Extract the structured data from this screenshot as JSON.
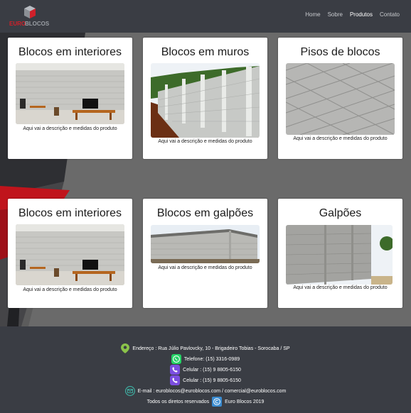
{
  "brand": {
    "logo_text": "EUROBLOCOS",
    "accent": "#d0202a"
  },
  "nav": {
    "items": [
      "Home",
      "Sobre",
      "Produtos",
      "Contato"
    ],
    "active": "Produtos"
  },
  "products": [
    {
      "title": "Blocos em interiores",
      "description": "Aqui vai a descrição e medidas do produto",
      "image": "interior-room"
    },
    {
      "title": "Blocos em muros",
      "description": "Aqui vai a descrição e medidas do produto",
      "image": "block-wall"
    },
    {
      "title": "Pisos de blocos",
      "description": "Aqui vai a descrição e medidas do produto",
      "image": "paving"
    },
    {
      "title": "Blocos em interiores",
      "description": "Aqui vai a descrição e medidas do produto",
      "image": "interior-room"
    },
    {
      "title": "Blocos em galpões",
      "description": "Aqui vai a descrição e medidas do produto",
      "image": "warehouse"
    },
    {
      "title": "Galpões",
      "description": "Aqui vai a descrição e medidas do produto",
      "image": "shed"
    }
  ],
  "footer": {
    "address": "Endereço : Rua Júlio Pavlovcky, 10 - Brigadeiro Tobias - Sorocaba / SP",
    "phone": "Telefone: (15) 3316-0989",
    "mobile1": "Celular : (15) 9 8805-6150",
    "mobile2": "Celular : (15) 9 8805-6150",
    "email": "E-mail : euroblocos@euroblocos.com / comercial@euroblocos.com",
    "rights": "Todos os diretos reservados",
    "copyright": "Euro Blocos 2019",
    "icons": {
      "address": "map-pin-icon",
      "phone": "whatsapp-icon",
      "mobile": "viber-phone-icon",
      "email": "mail-icon",
      "copyright": "copyright-icon"
    },
    "colors": {
      "pin": "#8bc34a",
      "whatsapp": "#25d366",
      "viber": "#7b4ee0",
      "mail": "#3fb6a8",
      "copyright": "#3a8bd0"
    }
  }
}
